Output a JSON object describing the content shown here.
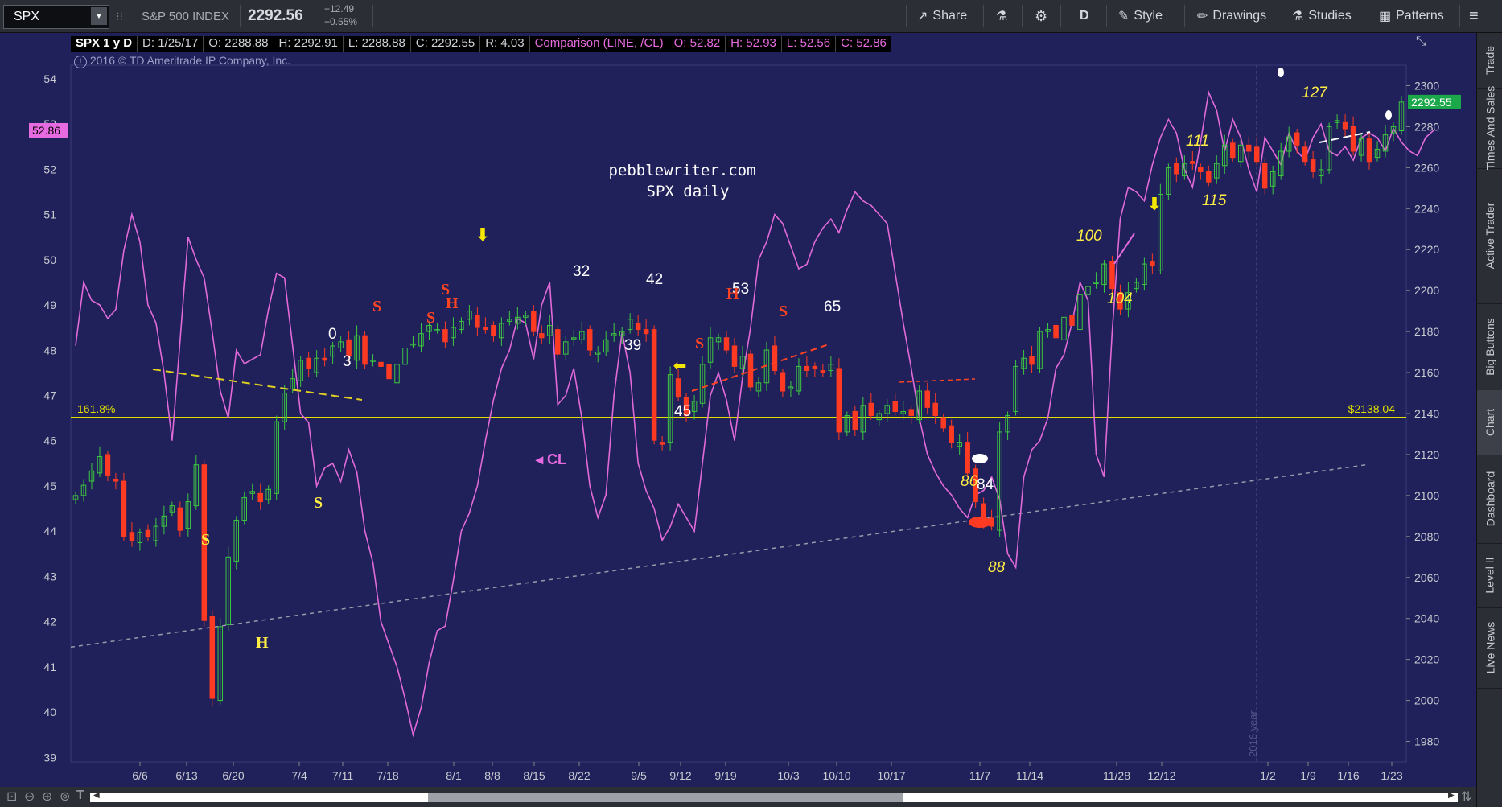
{
  "toolbar": {
    "symbol": "SPX",
    "instrument": "S&P 500 INDEX",
    "last": "2292.56",
    "change": "+12.49",
    "change_pct": "+0.55%",
    "share": "Share",
    "aggregation": "D",
    "style": "Style",
    "drawings": "Drawings",
    "studies": "Studies",
    "patterns": "Patterns"
  },
  "header": {
    "title": "SPX 1 y D",
    "d": "D: 1/25/17",
    "o": "O: 2288.88",
    "h": "H: 2292.91",
    "l": "L: 2288.88",
    "c": "C: 2292.55",
    "r": "R: 4.03",
    "comparison": "Comparison (LINE, /CL)",
    "co": "O: 52.82",
    "ch": "H: 52.93",
    "cl": "L: 52.56",
    "cc": "C: 52.86",
    "copyright": "2016 © TD Ameritrade IP Company, Inc."
  },
  "chart_data": {
    "type": "candlestick",
    "primary": "SPX",
    "comparison_series": "/CL",
    "right_axis": {
      "ticks": [
        "1980",
        "2000",
        "2020",
        "2040",
        "2060",
        "2080",
        "2100",
        "2120",
        "2140",
        "2160",
        "2180",
        "2200",
        "2220",
        "2240",
        "2260",
        "2280",
        "2300"
      ],
      "range": [
        1970,
        2310
      ]
    },
    "left_axis": {
      "ticks": [
        "39",
        "40",
        "41",
        "42",
        "43",
        "44",
        "45",
        "46",
        "47",
        "48",
        "49",
        "50",
        "51",
        "52",
        "53",
        "54"
      ],
      "range": [
        38.9,
        54.3
      ]
    },
    "x_ticks": [
      "6/6",
      "6/13",
      "6/20",
      "7/4",
      "7/11",
      "7/18",
      "8/1",
      "8/8",
      "8/15",
      "8/22",
      "9/5",
      "9/12",
      "9/19",
      "10/3",
      "10/10",
      "10/17",
      "11/7",
      "11/14",
      "11/28",
      "12/12",
      "1/2",
      "1/9",
      "1/16",
      "1/23"
    ],
    "price_label": "2292.55",
    "comparison_label": "52.86",
    "level_line": {
      "value": 2138.04,
      "label": "$2138.04",
      "fib": "161.8%"
    },
    "year_marker": "2016 year",
    "spx_close": [
      2100,
      2105,
      2112,
      2119,
      2110,
      2107,
      2080,
      2078,
      2082,
      2080,
      2085,
      2090,
      2095,
      2083,
      2097,
      2115,
      2039,
      2001,
      2036,
      2070,
      2088,
      2099,
      2102,
      2097,
      2103,
      2136,
      2150,
      2157,
      2166,
      2162,
      2167,
      2166,
      2173,
      2175,
      2168,
      2178,
      2164,
      2166,
      2163,
      2157,
      2164,
      2172,
      2174,
      2179,
      2183,
      2181,
      2175,
      2182,
      2185,
      2190,
      2182,
      2181,
      2178,
      2184,
      2186,
      2187,
      2188,
      2180,
      2177,
      2183,
      2169,
      2175,
      2177,
      2180,
      2171,
      2170,
      2176,
      2179,
      2180,
      2186,
      2181,
      2179,
      2127,
      2125,
      2159,
      2148,
      2139,
      2146,
      2164,
      2177,
      2177,
      2171,
      2163,
      2168,
      2153,
      2155,
      2171,
      2161,
      2151,
      2153,
      2163,
      2161,
      2162,
      2160,
      2164,
      2131,
      2139,
      2132,
      2144,
      2139,
      2140,
      2144,
      2141,
      2141,
      2139,
      2151,
      2143,
      2139,
      2133,
      2126,
      2126,
      2111,
      2097,
      2088,
      2085,
      2131,
      2139,
      2163,
      2167,
      2164,
      2180,
      2181,
      2177,
      2187,
      2183,
      2198,
      2202,
      2204,
      2213,
      2201,
      2191,
      2199,
      2204,
      2213,
      2212,
      2247,
      2260,
      2257,
      2262,
      2262,
      2258,
      2253,
      2262,
      2271,
      2265,
      2271,
      2268,
      2263,
      2250,
      2258,
      2268,
      2275,
      2271,
      2263,
      2258,
      2259,
      2280,
      2283,
      2279,
      2268,
      2274,
      2263,
      2269,
      2276,
      2280,
      2292
    ],
    "cl_close": [
      48.1,
      49.5,
      49.1,
      49.0,
      48.7,
      48.9,
      50.2,
      51.0,
      50.4,
      49.0,
      48.6,
      47.5,
      46.0,
      48.2,
      50.5,
      50.0,
      49.6,
      48.4,
      47.1,
      46.5,
      48.0,
      47.7,
      47.8,
      47.9,
      48.9,
      49.7,
      49.6,
      48.1,
      46.6,
      46.4,
      45.0,
      45.4,
      45.5,
      45.1,
      45.8,
      45.3,
      44.0,
      43.3,
      42.0,
      41.5,
      41.0,
      40.3,
      39.5,
      40.1,
      41.1,
      41.8,
      41.9,
      42.9,
      44.0,
      44.4,
      45.0,
      46.0,
      46.9,
      47.6,
      48.0,
      48.7,
      48.6,
      47.8,
      49.0,
      49.5,
      46.8,
      47.0,
      47.6,
      46.5,
      45.0,
      44.3,
      44.8,
      47.0,
      48.4,
      47.5,
      45.5,
      44.9,
      44.5,
      43.8,
      44.1,
      44.6,
      44.3,
      44.0,
      45.5,
      47.0,
      47.5,
      46.9,
      46.0,
      47.4,
      48.5,
      50.0,
      50.4,
      51.0,
      50.8,
      50.3,
      49.8,
      49.9,
      50.4,
      50.7,
      50.9,
      50.6,
      51.1,
      51.5,
      51.3,
      51.2,
      51.0,
      50.8,
      49.7,
      48.6,
      47.6,
      46.5,
      45.7,
      45.3,
      45.0,
      44.8,
      44.5,
      44.3,
      44.8,
      44.9,
      45.2,
      44.7,
      43.5,
      43.2,
      45.2,
      45.8,
      46.0,
      46.5,
      47.6,
      47.9,
      48.6,
      49.5,
      49.1,
      45.7,
      45.2,
      48.4,
      50.9,
      51.6,
      51.5,
      51.3,
      52.1,
      52.7,
      53.1,
      52.8,
      52.0,
      51.6,
      52.6,
      53.7,
      53.3,
      52.4,
      53.1,
      52.7,
      52.0,
      51.5,
      52.7,
      52.4,
      52.1,
      52.8,
      52.4,
      52.2,
      52.7,
      53.0,
      52.4,
      52.3,
      52.5,
      52.2,
      52.7,
      52.8,
      52.7,
      52.4,
      52.9,
      52.6,
      52.4,
      52.3,
      52.7,
      52.86
    ]
  },
  "annotations": {
    "site": "pebblewriter.com",
    "subtitle": "SPX daily",
    "cl_marker": "CL",
    "wave_labels": [
      {
        "t": "0",
        "c": "#ffffff"
      },
      {
        "t": "3",
        "c": "#ffffff"
      },
      {
        "t": "32",
        "c": "#ffffff"
      },
      {
        "t": "42",
        "c": "#ffffff"
      },
      {
        "t": "39",
        "c": "#ffffff"
      },
      {
        "t": "45",
        "c": "#ffffff"
      },
      {
        "t": "53",
        "c": "#ffffff"
      },
      {
        "t": "65",
        "c": "#ffffff"
      },
      {
        "t": "84",
        "c": "#ffffff"
      },
      {
        "t": "86",
        "c": "#ffee44"
      },
      {
        "t": "88",
        "c": "#ffee44"
      },
      {
        "t": "100",
        "c": "#ffee44"
      },
      {
        "t": "104",
        "c": "#ffee44"
      },
      {
        "t": "111",
        "c": "#ffee44"
      },
      {
        "t": "115",
        "c": "#ffee44"
      },
      {
        "t": "127",
        "c": "#ffee44"
      }
    ],
    "hs_labels": [
      {
        "t": "S",
        "c": "#ffee44"
      },
      {
        "t": "H",
        "c": "#ffee44"
      },
      {
        "t": "S",
        "c": "#ffee44"
      },
      {
        "t": "S",
        "c": "#ff4422"
      },
      {
        "t": "S",
        "c": "#ff4422"
      },
      {
        "t": "H",
        "c": "#ff4422"
      },
      {
        "t": "S",
        "c": "#ff4422"
      },
      {
        "t": "S",
        "c": "#ff4422"
      },
      {
        "t": "H",
        "c": "#ff4422"
      },
      {
        "t": "S",
        "c": "#ff4422"
      }
    ]
  },
  "sidebar": [
    "Trade",
    "Times And Sales",
    "Active Trader",
    "Big Buttons",
    "Chart",
    "Dashboard",
    "Level II",
    "Live News"
  ],
  "colors": {
    "bg": "#20205a",
    "up": "#3cc840",
    "down": "#ff3a22",
    "cl": "#e06ad8",
    "level": "#e0e000"
  }
}
